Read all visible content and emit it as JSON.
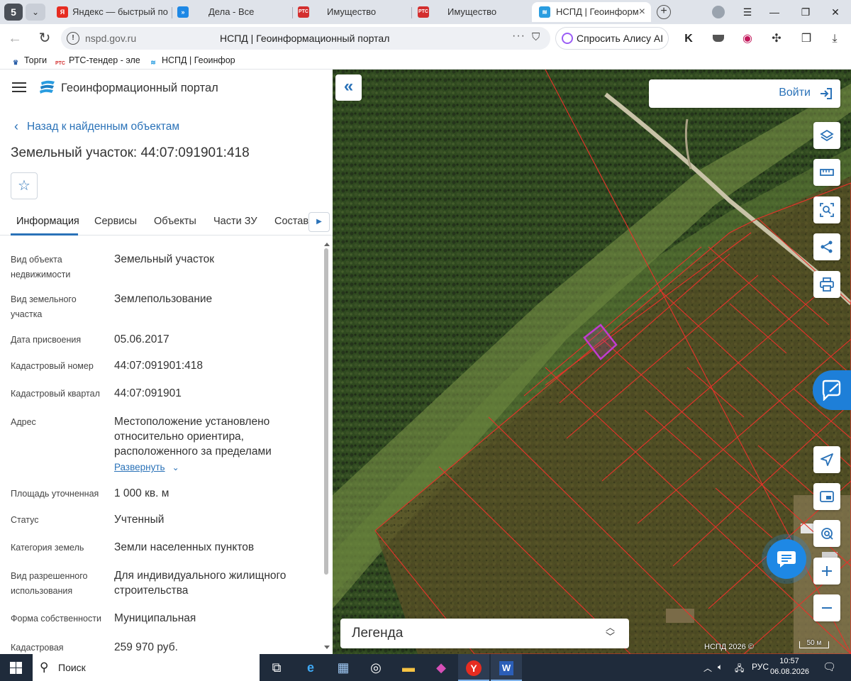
{
  "browser": {
    "tab_count": "5",
    "tabs": [
      {
        "title": "Яндекс — быстрый по",
        "favicon": "yandex-icon"
      },
      {
        "title": "Дела - Все",
        "favicon": "double-arrow-icon"
      },
      {
        "title": "Имущество",
        "favicon": "rts-icon"
      },
      {
        "title": "Имущество",
        "favicon": "rts-icon"
      },
      {
        "title": "НСПД | Геоинформ",
        "favicon": "nspd-icon"
      }
    ],
    "address": {
      "domain": "nspd.gov.ru",
      "page_title": "НСПД | Геоинформационный портал",
      "alice_label": "Спросить Алису AI"
    },
    "bookmarks": [
      {
        "label": "Торги",
        "icon": "eagle-icon"
      },
      {
        "label": "РТС-тендер - эле",
        "icon": "rts-icon"
      },
      {
        "label": "НСПД | Геоинфор",
        "icon": "nspd-icon"
      }
    ]
  },
  "portal": {
    "title": "Геоинформационный портал",
    "back_label": "Назад к найденным объектам",
    "object_title": "Земельный участок: 44:07:091901:418",
    "tabs": [
      "Информация",
      "Сервисы",
      "Объекты",
      "Части ЗУ",
      "Состав"
    ],
    "expand_label": "Развернуть",
    "fields": [
      {
        "label": [
          "Вид объекта",
          "недвижимости"
        ],
        "value": [
          "Земельный участок"
        ]
      },
      {
        "label": [
          "Вид земельного",
          "участка"
        ],
        "value": [
          "Землепользование"
        ]
      },
      {
        "label": [
          "Дата присвоения"
        ],
        "value": [
          "05.06.2017"
        ]
      },
      {
        "label": [
          "Кадастровый номер"
        ],
        "value": [
          "44:07:091901:418"
        ]
      },
      {
        "label": [
          "Кадастровый квартал"
        ],
        "value": [
          "44:07:091901"
        ]
      },
      {
        "label": [
          "Адрес"
        ],
        "value": [
          "Местоположение установлено",
          "относительно ориентира,",
          "расположенного за пределами"
        ]
      },
      {
        "label": [
          "Площадь уточненная"
        ],
        "value": [
          "1 000 кв. м"
        ]
      },
      {
        "label": [
          "Статус"
        ],
        "value": [
          "Учтенный"
        ]
      },
      {
        "label": [
          "Категория земель"
        ],
        "value": [
          "Земли населенных пунктов"
        ]
      },
      {
        "label": [
          "Вид разрешенного",
          "использования"
        ],
        "value": [
          "Для индивидуального жилищного",
          "строительства"
        ]
      },
      {
        "label": [
          "Форма собственности"
        ],
        "value": [
          "Муниципальная"
        ]
      },
      {
        "label": [
          "Кадастровая"
        ],
        "value": [
          "259 970 руб."
        ]
      }
    ]
  },
  "map": {
    "login_label": "Войти",
    "legend_label": "Легенда",
    "attribution": "НСПД 2026 ©",
    "scale_label": "50 м",
    "tools": [
      "layers-icon",
      "ruler-icon",
      "select-area-icon",
      "share-icon",
      "print-icon"
    ],
    "nav_tools": [
      "locate-icon",
      "minimap-icon",
      "geolocation-icon",
      "zoom-in-icon",
      "zoom-out-icon"
    ],
    "colors": {
      "parcel_border": "#e8322a",
      "selected_parcel": "#c23bd1",
      "accent": "#2a72b8"
    }
  },
  "taskbar": {
    "search_label": "Поиск",
    "language": "РУС",
    "time": "10:57",
    "date": "06.08.2026"
  }
}
